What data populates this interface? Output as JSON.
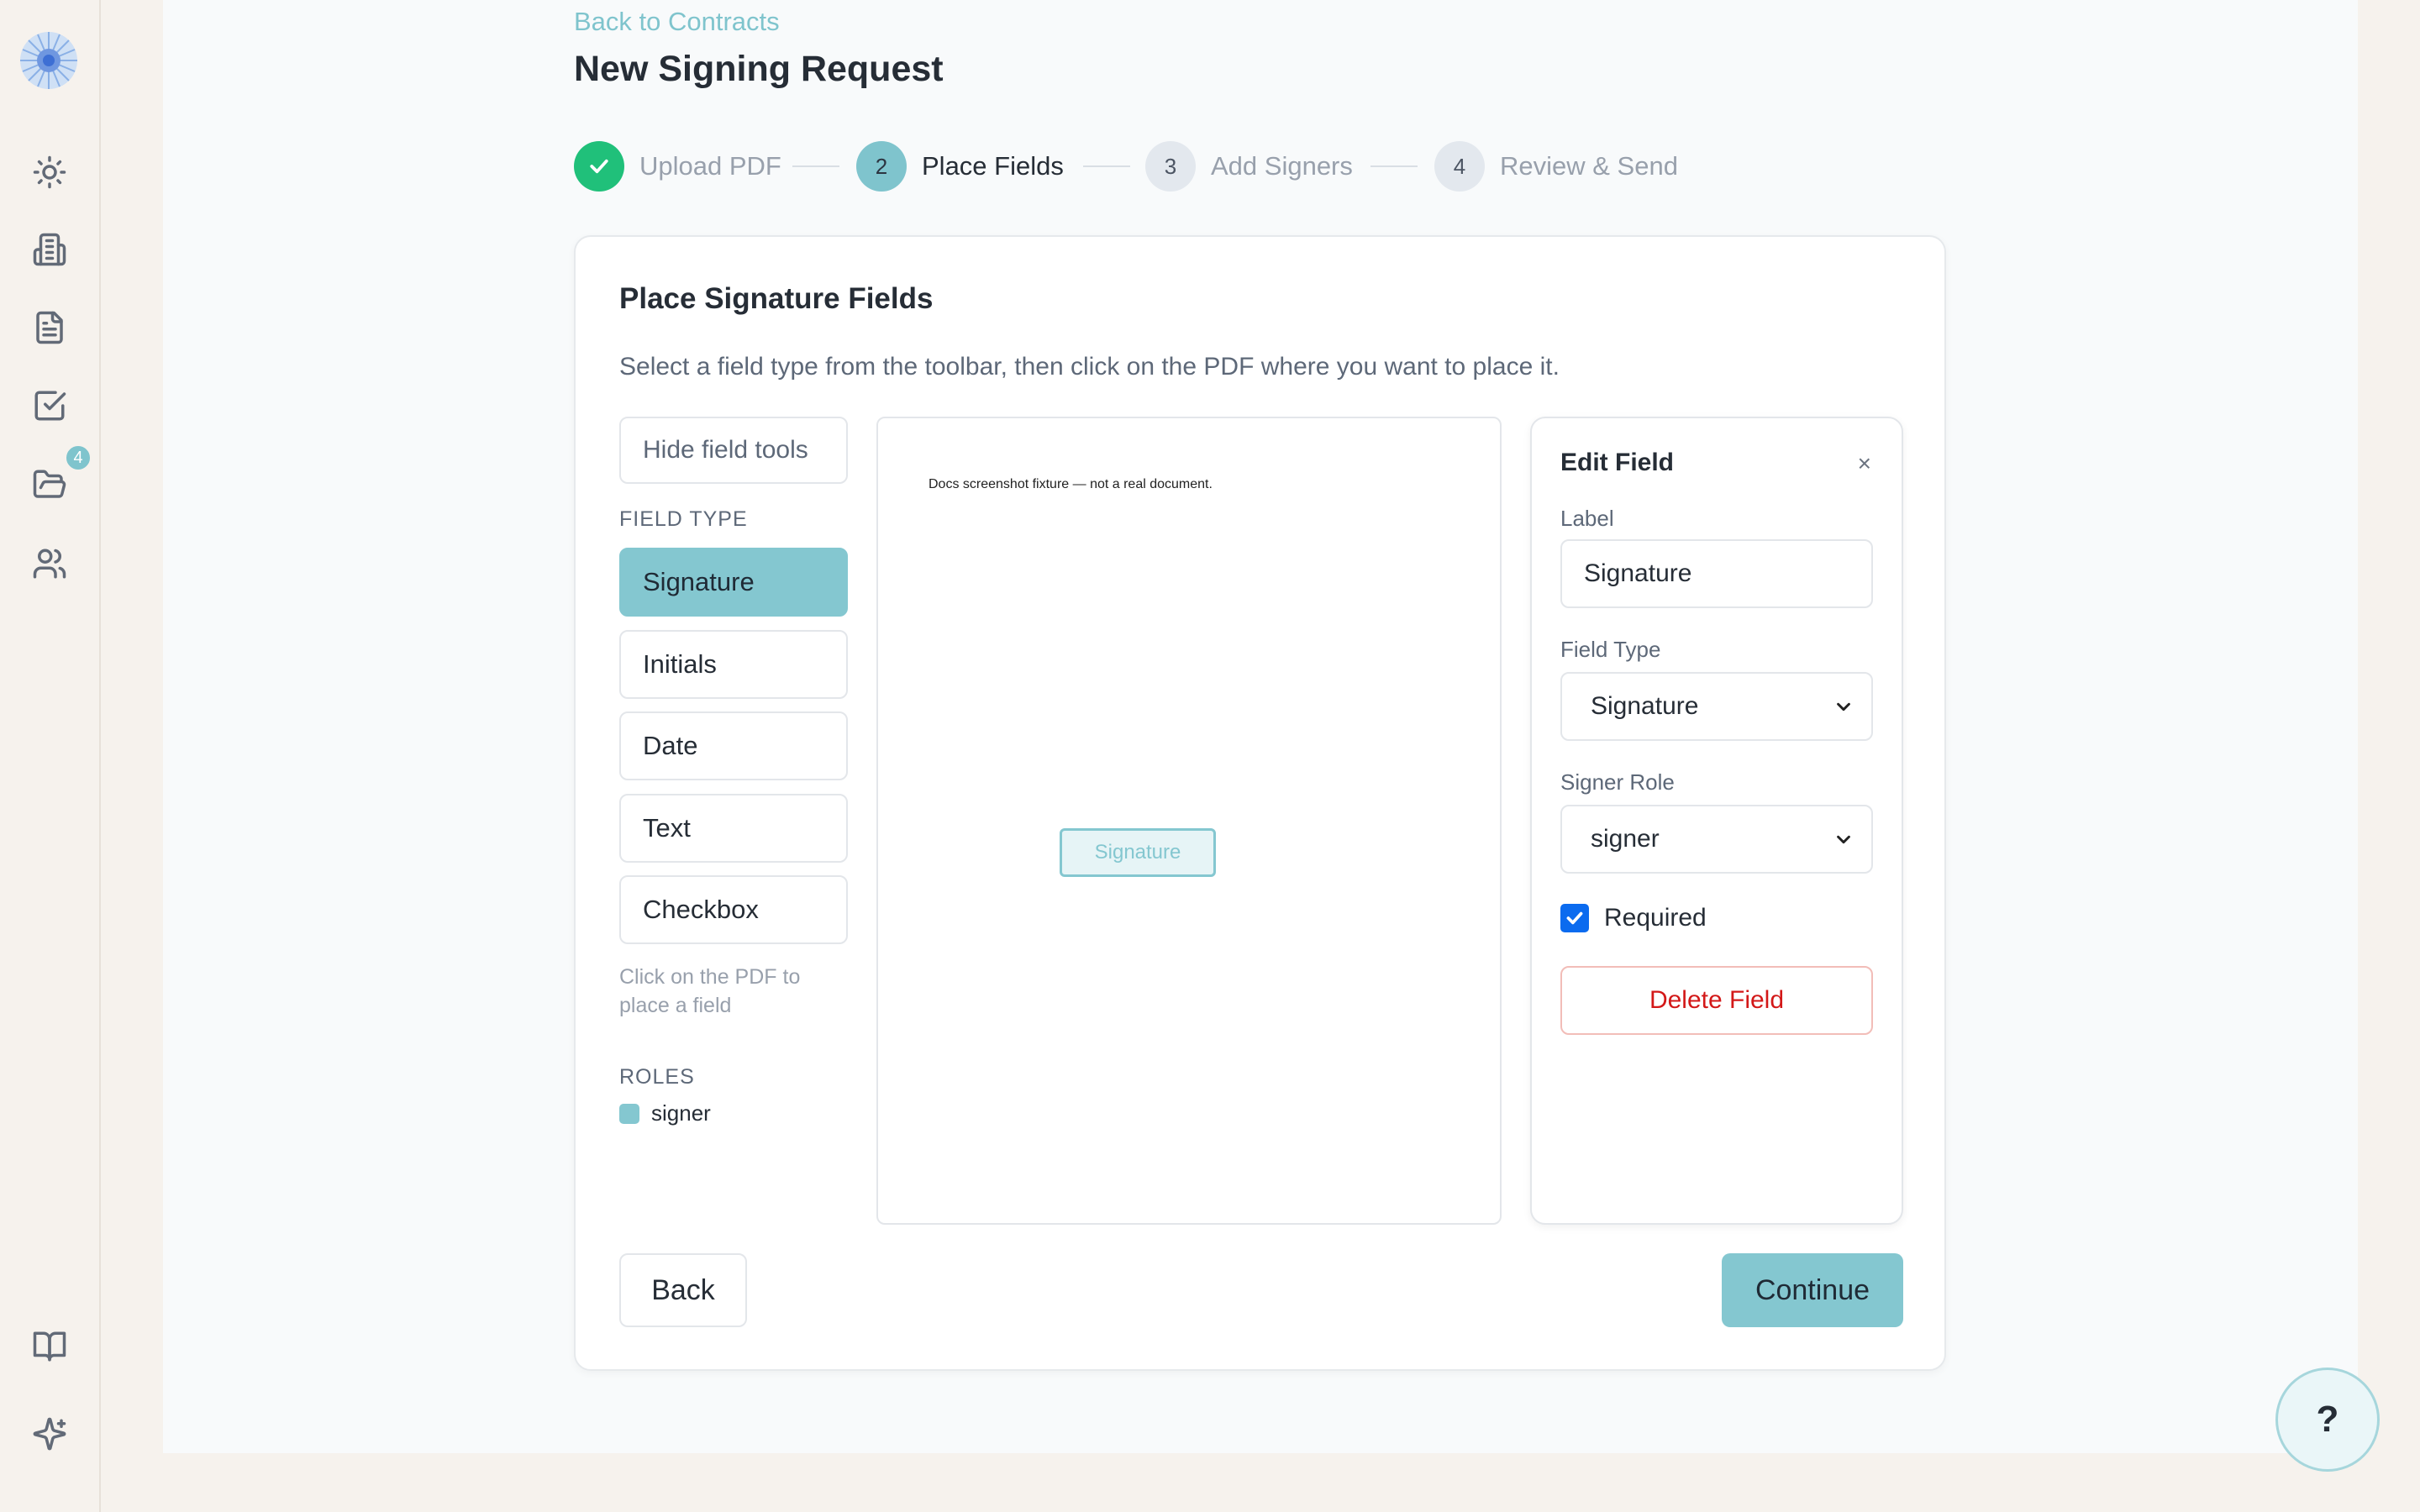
{
  "header": {
    "back_link": "Back to Contracts",
    "title": "New Signing Request"
  },
  "sidebar": {
    "badge_count": "4",
    "icons": [
      "sun-icon",
      "building-icon",
      "document-icon",
      "checkbox-icon",
      "folder-icon",
      "users-icon",
      "book-icon",
      "sparkle-icon"
    ]
  },
  "stepper": {
    "steps": [
      {
        "number": "1",
        "label": "Upload PDF",
        "state": "done"
      },
      {
        "number": "2",
        "label": "Place Fields",
        "state": "active"
      },
      {
        "number": "3",
        "label": "Add Signers",
        "state": "pending"
      },
      {
        "number": "4",
        "label": "Review & Send",
        "state": "pending"
      }
    ]
  },
  "card": {
    "title": "Place Signature Fields",
    "description": "Select a field type from the toolbar, then click on the PDF where you want to place it."
  },
  "tools": {
    "hide_label": "Hide field tools",
    "field_type_heading": "FIELD TYPE",
    "field_types": [
      "Signature",
      "Initials",
      "Date",
      "Text",
      "Checkbox"
    ],
    "selected": "Signature",
    "hint": "Click on the PDF to place a field",
    "roles_heading": "ROLES",
    "roles": [
      "signer"
    ]
  },
  "pdf": {
    "text": "Docs screenshot fixture — not a real document.",
    "placed_field_label": "Signature"
  },
  "edit_field": {
    "title": "Edit Field",
    "close": "×",
    "label_caption": "Label",
    "label_value": "Signature",
    "field_type_caption": "Field Type",
    "field_type_value": "Signature",
    "signer_role_caption": "Signer Role",
    "signer_role_value": "signer",
    "required_label": "Required",
    "required": true,
    "delete_label": "Delete Field"
  },
  "footer": {
    "back_label": "Back",
    "continue_label": "Continue"
  },
  "help": {
    "label": "?"
  },
  "colors": {
    "accent": "#84c7d0",
    "success": "#20c07a",
    "danger": "#d31818",
    "checkbox": "#0b6bef"
  }
}
